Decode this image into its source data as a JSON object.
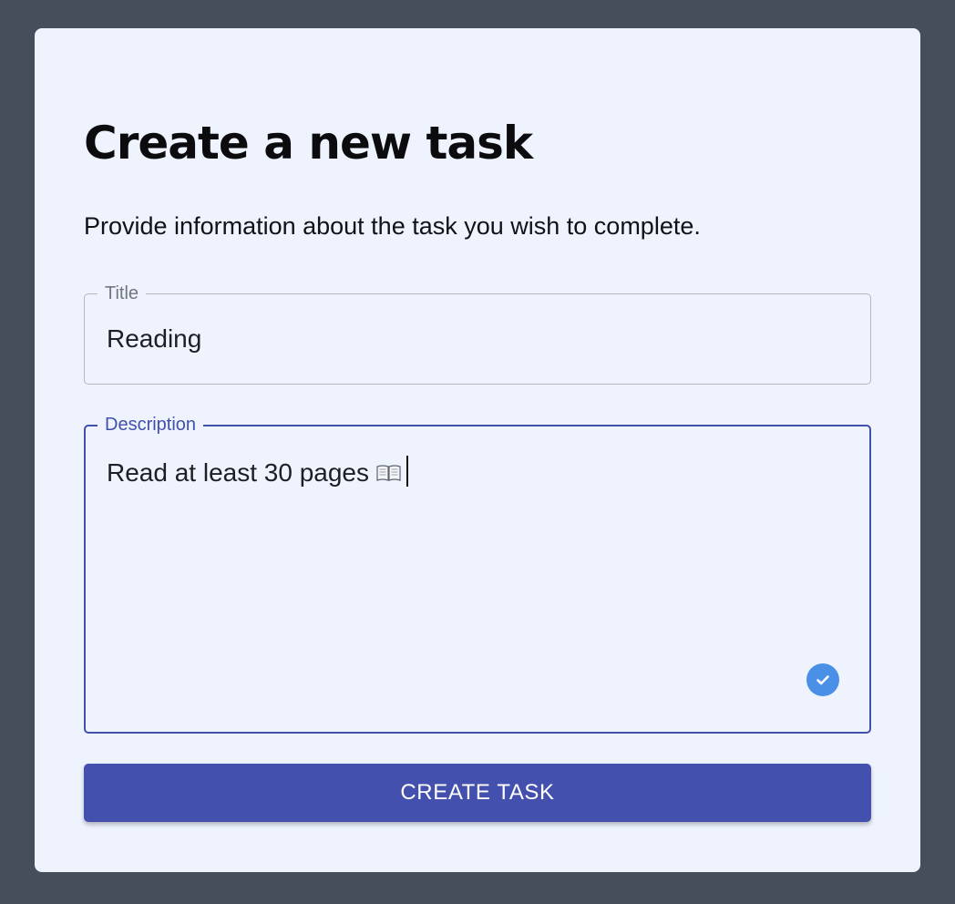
{
  "form": {
    "heading": "Create a new task",
    "subtitle": "Provide information about the task you wish to complete.",
    "title_field": {
      "label": "Title",
      "value": "Reading"
    },
    "description_field": {
      "label": "Description",
      "value": "Read at least 30 pages",
      "icon": "open-book-icon",
      "status_icon": "check-circle-icon",
      "focused": true
    },
    "submit_label": "CREATE TASK"
  },
  "colors": {
    "backdrop": "#464e5c",
    "card": "#eef3fd",
    "accent": "#4450ae",
    "check_badge": "#4a90e6"
  }
}
